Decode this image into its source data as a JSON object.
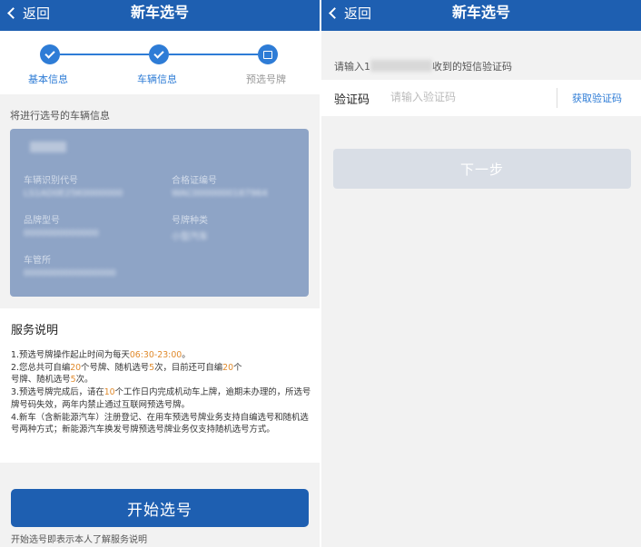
{
  "left": {
    "nav": {
      "back": "返回",
      "title": "新车选号"
    },
    "steps": [
      {
        "label": "基本信息"
      },
      {
        "label": "车辆信息"
      },
      {
        "label": "预选号牌"
      }
    ],
    "section_label": "将进行选号的车辆信息",
    "vehicle": {
      "vin_label": "车辆识别代号",
      "vin_value": "LS1AD0E25K0000000",
      "cert_label": "合格证编号",
      "cert_value": "WAC0000000187964",
      "model_label": "品牌型号",
      "model_value": "0000000000000",
      "plate_type_label": "号牌种类",
      "plate_type_value": "小型汽车",
      "office_label": "车管所",
      "office_value": "0000000000000000"
    },
    "service": {
      "title": "服务说明",
      "l1a": "1.预选号牌操作起止时间为每天",
      "l1b": "06:30-23:00",
      "l1c": "。",
      "l2a": "2.您总共可自编",
      "l2b": "20",
      "l2c": "个号牌、随机选号",
      "l2d": "5",
      "l2e": "次，目前还可自编",
      "l2f": "20",
      "l2g": "个",
      "l2h": "号牌、随机选号",
      "l2i": "5",
      "l2j": "次。",
      "l3a": "3.预选号牌完成后，请在",
      "l3b": "10",
      "l3c": "个工作日内完成机动车上牌，逾期未办理的，所选号牌号码失效，两年内禁止通过互联网预选号牌。",
      "l4": "4.新车（含新能源汽车）注册登记、在用车预选号牌业务支持自编选号和随机选号两种方式；新能源汽车换发号牌预选号牌业务仅支持随机选号方式。"
    },
    "start_button": "开始选号",
    "footer_note": "开始选号即表示本人了解服务说明"
  },
  "right": {
    "nav": {
      "back": "返回",
      "title": "新车选号"
    },
    "hint_prefix": "请输入1",
    "hint_suffix": "收到的短信验证码",
    "code_label": "验证码",
    "code_placeholder": "请输入验证码",
    "get_code": "获取验证码",
    "next_button": "下一步"
  },
  "colors": {
    "primary": "#1e5fb1",
    "accent": "#2e7cd6",
    "highlight": "#e08a2c",
    "card": "#8ea4c6",
    "disabled": "#d9dee6"
  }
}
